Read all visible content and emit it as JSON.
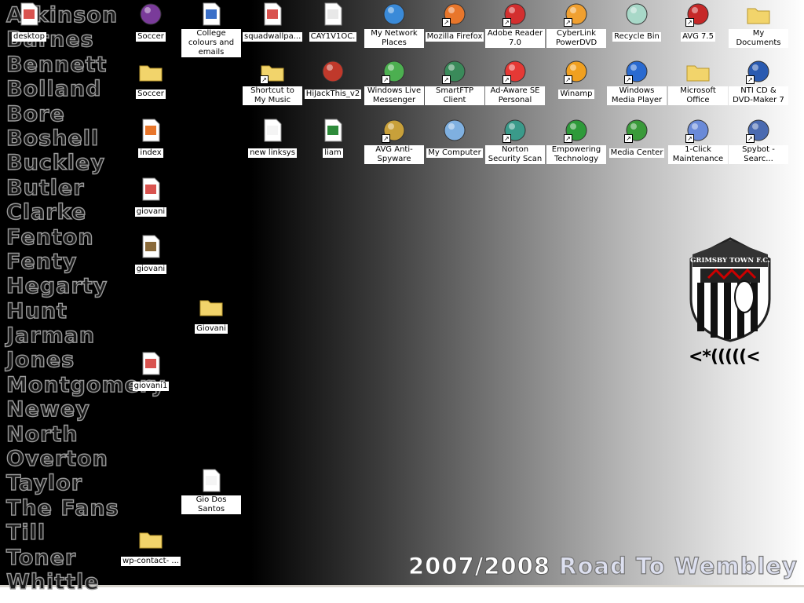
{
  "wallpaper": {
    "player_names": [
      "Atkinson",
      "Barnes",
      "Bennett",
      "Bolland",
      "Bore",
      "Boshell",
      "Buckley",
      "Butler",
      "Clarke",
      "Fenton",
      "Fenty",
      "Hegarty",
      "Hunt",
      "Jarman",
      "Jones",
      "Montgomery",
      "Newey",
      "North",
      "Overton",
      "Taylor",
      "The Fans",
      "Till",
      "Toner",
      "Whittle"
    ],
    "slogan_years": "2007/2008",
    "slogan_text": "Road To Wembley",
    "crest_text": "GRIMSBY TOWN F.C.",
    "fish_text": "<*(((((<"
  },
  "icons": [
    {
      "label": "desktop",
      "icon": "powerpoint-file-icon",
      "color": "#d9534f",
      "shortcut": false
    },
    {
      "label": "Soccer",
      "icon": "winrar-archive-icon",
      "color": "#7a3b9a",
      "shortcut": false
    },
    {
      "label": "Soccer",
      "icon": "folder-icon",
      "color": "#f2d46b",
      "shortcut": false
    },
    {
      "label": "index",
      "icon": "firefox-html-file-icon",
      "color": "#e8762b",
      "shortcut": false
    },
    {
      "label": "giovani",
      "icon": "powerpoint-file-icon",
      "color": "#d9534f",
      "shortcut": false
    },
    {
      "label": "giovani",
      "icon": "winrar-file-icon",
      "color": "#8a6a3a",
      "shortcut": false
    },
    {
      "label": "giovani1",
      "icon": "powerpoint-file-icon",
      "color": "#d9534f",
      "shortcut": false
    },
    {
      "label": "wp-contact- ...",
      "icon": "folder-icon",
      "color": "#f2d46b",
      "shortcut": false
    },
    {
      "label": "College colours and emails",
      "icon": "word-document-icon",
      "color": "#3a6fc8",
      "shortcut": false
    },
    {
      "label": "Giovani",
      "icon": "folder-icon",
      "color": "#f2d46b",
      "shortcut": false
    },
    {
      "label": "Gio Dos Santos",
      "icon": "text-file-icon",
      "color": "#f4f4f4",
      "shortcut": false
    },
    {
      "label": "squadwallpa...",
      "icon": "powerpoint-file-icon",
      "color": "#d9534f",
      "shortcut": false
    },
    {
      "label": "Shortcut to My Music",
      "icon": "music-folder-icon",
      "color": "#f2d46b",
      "shortcut": true
    },
    {
      "label": "new linksys",
      "icon": "text-file-icon",
      "color": "#f4f4f4",
      "shortcut": false
    },
    {
      "label": "CAY1V1OC.",
      "icon": "image-file-icon",
      "color": "#e8e8e8",
      "shortcut": false
    },
    {
      "label": "HiJackThis_v2",
      "icon": "hijackthis-icon",
      "color": "#c0392b",
      "shortcut": false
    },
    {
      "label": "liam",
      "icon": "excel-file-icon",
      "color": "#2e8b3a",
      "shortcut": false
    },
    {
      "label": "My Network Places",
      "icon": "network-places-icon",
      "color": "#3a8ad8",
      "shortcut": false
    },
    {
      "label": "Windows Live Messenger",
      "icon": "messenger-icon",
      "color": "#4caf50",
      "shortcut": true
    },
    {
      "label": "AVG Anti-Spyware",
      "icon": "avg-antispyware-icon",
      "color": "#c8a03a",
      "shortcut": true
    },
    {
      "label": "Mozilla Firefox",
      "icon": "firefox-icon",
      "color": "#e8762b",
      "shortcut": true
    },
    {
      "label": "SmartFTP Client",
      "icon": "smartftp-icon",
      "color": "#3a8a5a",
      "shortcut": true
    },
    {
      "label": "My Computer",
      "icon": "my-computer-icon",
      "color": "#7fb0e0",
      "shortcut": false
    },
    {
      "label": "Adobe Reader 7.0",
      "icon": "adobe-reader-icon",
      "color": "#d32f2f",
      "shortcut": true
    },
    {
      "label": "Ad-Aware SE Personal",
      "icon": "adaware-icon",
      "color": "#e53935",
      "shortcut": true
    },
    {
      "label": "Norton Security Scan",
      "icon": "norton-icon",
      "color": "#3a9a8a",
      "shortcut": true
    },
    {
      "label": "CyberLink PowerDVD",
      "icon": "powerdvd-icon",
      "color": "#f0a030",
      "shortcut": true
    },
    {
      "label": "Winamp",
      "icon": "winamp-icon",
      "color": "#f0a020",
      "shortcut": true
    },
    {
      "label": "Empowering Technology",
      "icon": "empowering-technology-icon",
      "color": "#2e9a3a",
      "shortcut": true
    },
    {
      "label": "Recycle Bin",
      "icon": "recycle-bin-icon",
      "color": "#a8d8c8",
      "shortcut": false
    },
    {
      "label": "Windows Media Player",
      "icon": "media-player-icon",
      "color": "#2a6ad0",
      "shortcut": true
    },
    {
      "label": "Media Center",
      "icon": "media-center-icon",
      "color": "#3a9a3a",
      "shortcut": true
    },
    {
      "label": "AVG 7.5",
      "icon": "avg-icon",
      "color": "#c62828",
      "shortcut": true
    },
    {
      "label": "Microsoft Office",
      "icon": "folder-icon",
      "color": "#f2d46b",
      "shortcut": false
    },
    {
      "label": "1-Click Maintenance",
      "icon": "maintenance-icon",
      "color": "#6a8ad8",
      "shortcut": true
    },
    {
      "label": "My Documents",
      "icon": "my-documents-icon",
      "color": "#f2d46b",
      "shortcut": false
    },
    {
      "label": "NTI CD & DVD-Maker 7",
      "icon": "nti-icon",
      "color": "#2a5ab0",
      "shortcut": true
    },
    {
      "label": "Spybot - Searc...",
      "icon": "spybot-icon",
      "color": "#4a6ab0",
      "shortcut": true
    }
  ]
}
